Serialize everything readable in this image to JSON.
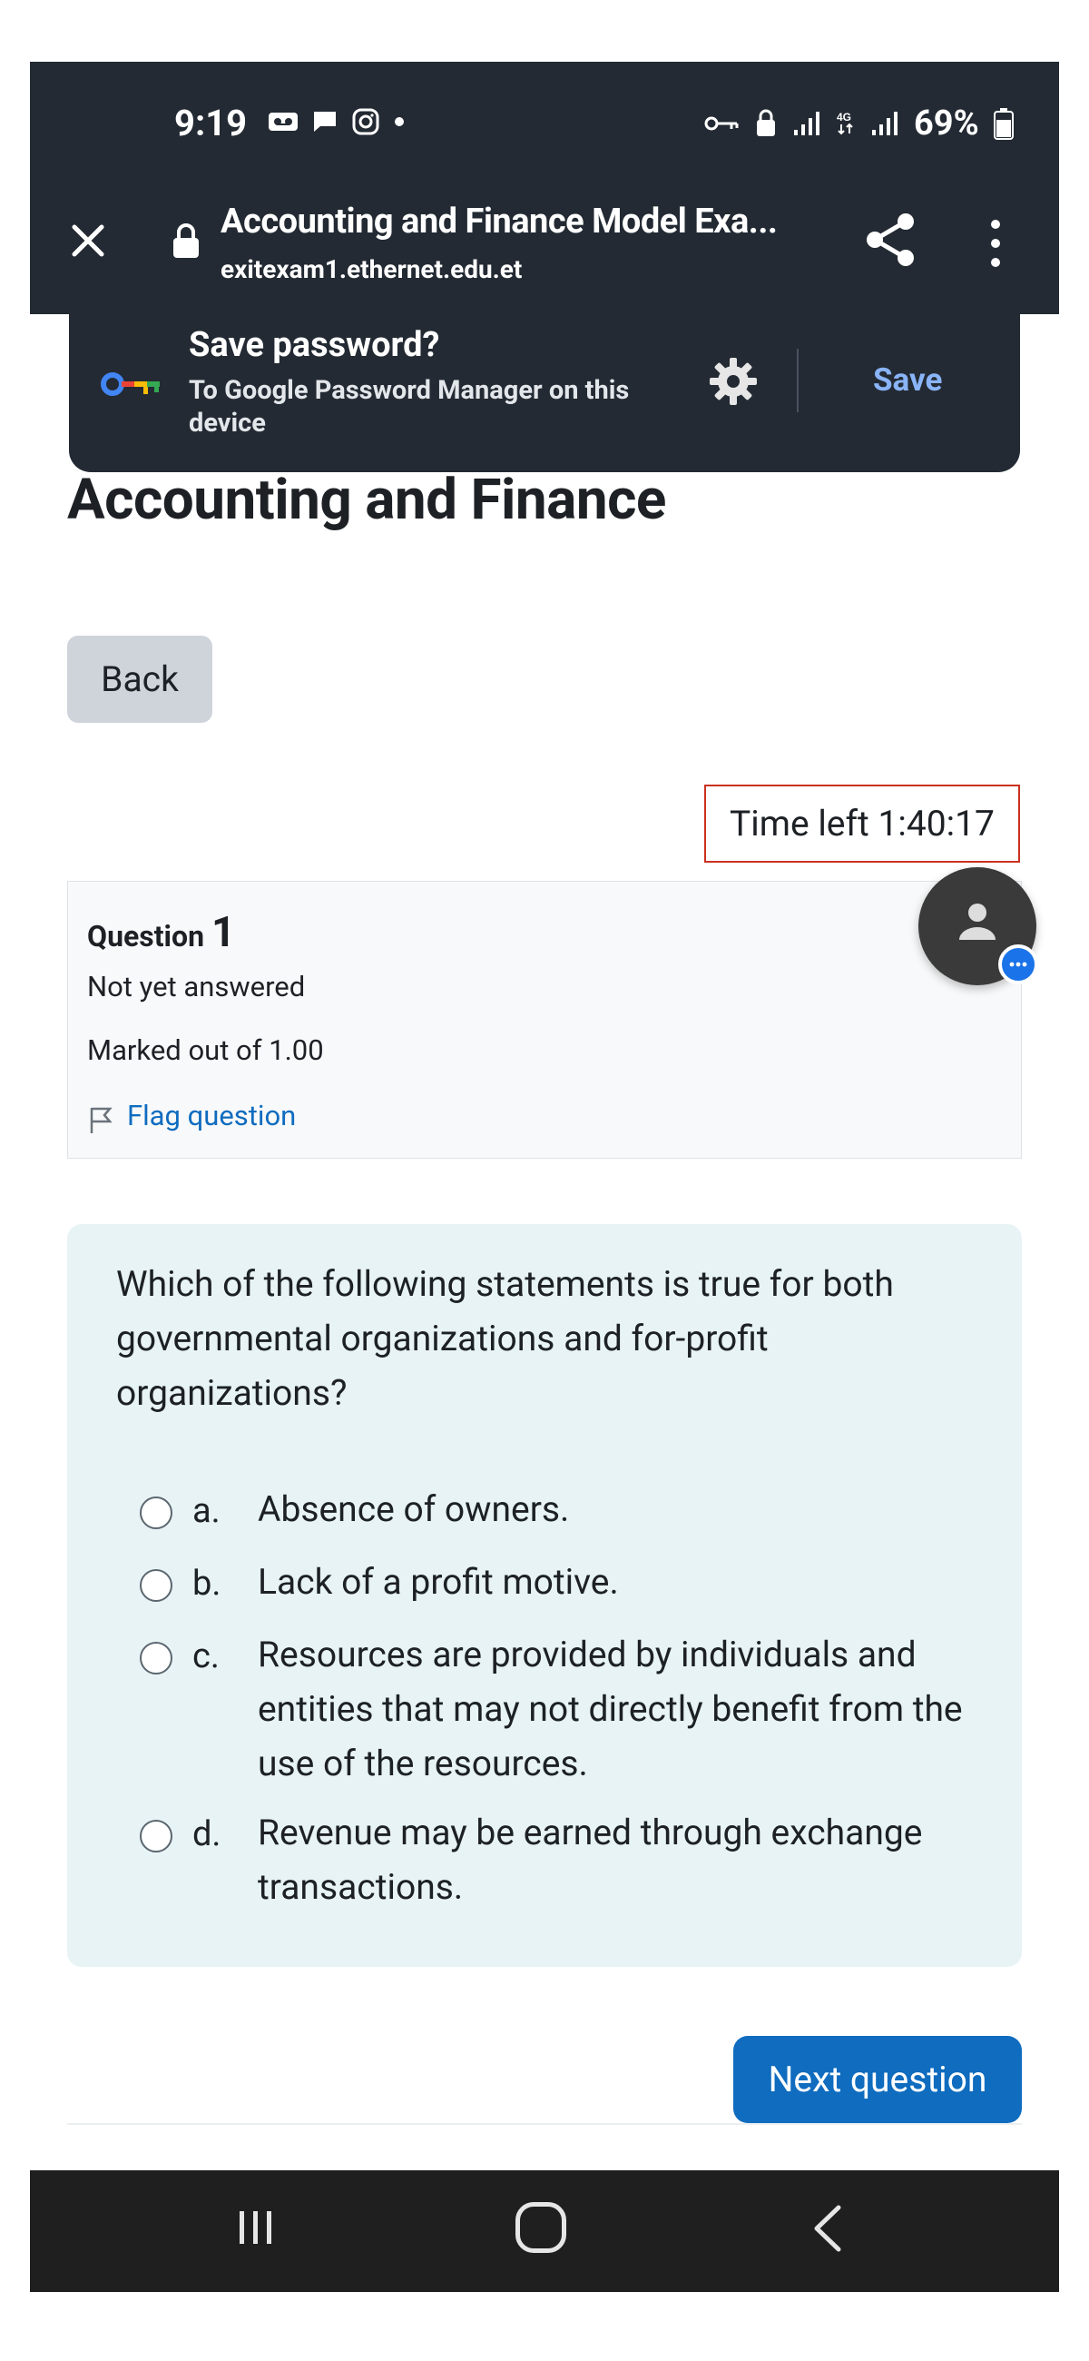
{
  "status_bar": {
    "time": "9:19",
    "battery": "69%"
  },
  "browser": {
    "page_title": "Accounting and Finance Model Exa...",
    "host": "exitexam1.ethernet.edu.et"
  },
  "save_password": {
    "title": "Save password?",
    "subtitle": "To Google Password Manager on this device",
    "save_label": "Save"
  },
  "page": {
    "heading": "Accounting and Finance",
    "back_label": "Back",
    "timer": "Time left 1:40:17"
  },
  "question_info": {
    "label": "Question",
    "number": "1",
    "status": "Not yet answered",
    "marks": "Marked out of 1.00",
    "flag_label": "Flag question"
  },
  "question": {
    "text": "Which of the following statements is true for both governmental organizations and for-profit organizations?",
    "options": [
      {
        "letter": "a.",
        "text": "Absence of owners."
      },
      {
        "letter": "b.",
        "text": "Lack of a profit motive."
      },
      {
        "letter": "c.",
        "text": "Resources are provided by individuals and entities that may not directly benefit from the use of the resources."
      },
      {
        "letter": "d.",
        "text": "Revenue may be earned through exchange transactions."
      }
    ]
  },
  "navigation": {
    "next_label": "Next question"
  },
  "colors": {
    "primary": "#0f6cbf",
    "dark_bar": "#232a33",
    "timer_border": "#ca3120",
    "question_bg": "#e7f3f5"
  }
}
